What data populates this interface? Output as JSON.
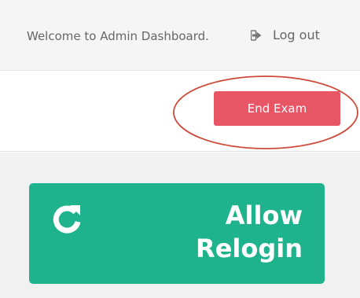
{
  "header": {
    "welcome_text": "Welcome to Admin Dashboard.",
    "logout_label": "Log out",
    "logout_icon": "sign-out-icon"
  },
  "actions": {
    "end_exam_label": "End Exam",
    "end_exam_color": "#e85565",
    "annotation_color": "#cc4a3a"
  },
  "relogin_card": {
    "icon": "refresh-icon",
    "line1": "Allow",
    "line2": "Relogin",
    "color": "#1eb38c"
  }
}
